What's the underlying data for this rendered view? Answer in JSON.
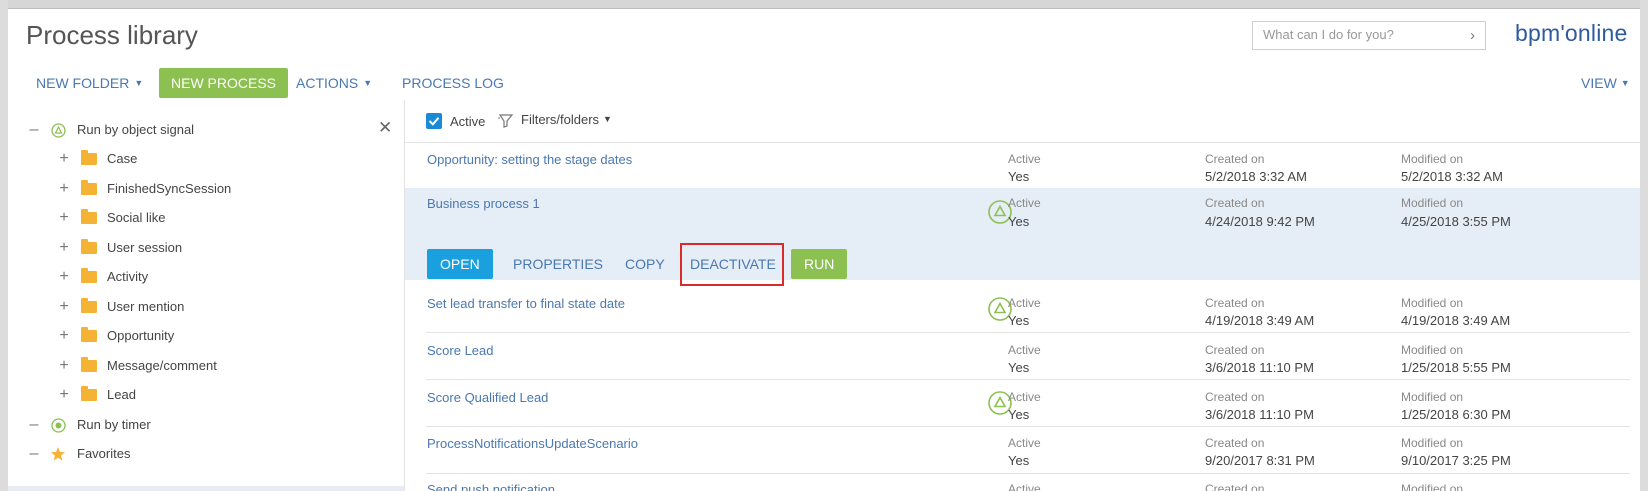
{
  "header": {
    "title": "Process library",
    "search_placeholder": "What can I do for you?",
    "brand": "bpm'online"
  },
  "toolbar": {
    "new_folder": "NEW FOLDER",
    "new_process": "NEW PROCESS",
    "actions": "ACTIONS",
    "process_log": "PROCESS LOG",
    "view": "VIEW"
  },
  "sidebar": {
    "root_signal": "Run by object signal",
    "folders": [
      "Case",
      "FinishedSyncSession",
      "Social like",
      "User session",
      "Activity",
      "User mention",
      "Opportunity",
      "Message/comment",
      "Lead"
    ],
    "timer": "Run by timer",
    "favorites": "Favorites"
  },
  "filter": {
    "active_label": "Active",
    "active_checked": true,
    "filters_label": "Filters/folders"
  },
  "columns": {
    "active": "Active",
    "created": "Created on",
    "modified": "Modified on"
  },
  "rows": [
    {
      "name": "Opportunity: setting the stage dates",
      "active": "Yes",
      "created": "5/2/2018 3:32 AM",
      "modified": "5/2/2018 3:32 AM",
      "signal": false
    },
    {
      "name": "Business process 1",
      "active": "Yes",
      "created": "4/24/2018 9:42 PM",
      "modified": "4/25/2018 3:55 PM",
      "signal": true
    },
    {
      "name": "Set lead transfer to final state date",
      "active": "Yes",
      "created": "4/19/2018 3:49 AM",
      "modified": "4/19/2018 3:49 AM",
      "signal": true
    },
    {
      "name": "Score Lead",
      "active": "Yes",
      "created": "3/6/2018 11:10 PM",
      "modified": "1/25/2018 5:55 PM",
      "signal": false
    },
    {
      "name": "Score Qualified Lead",
      "active": "Yes",
      "created": "3/6/2018 11:10 PM",
      "modified": "1/25/2018 6:30 PM",
      "signal": true
    },
    {
      "name": "ProcessNotificationsUpdateScenario",
      "active": "Yes",
      "created": "9/20/2017 8:31 PM",
      "modified": "9/10/2017 3:25 PM",
      "signal": false
    },
    {
      "name": "Send push notification",
      "active": "",
      "created": "",
      "modified": "",
      "signal": false
    }
  ],
  "row_actions": {
    "open": "OPEN",
    "properties": "PROPERTIES",
    "copy": "COPY",
    "deactivate": "DEACTIVATE",
    "run": "RUN"
  },
  "colors": {
    "accent_green": "#8cc152",
    "accent_blue": "#1aa0df",
    "link": "#4a78b0",
    "highlight": "#d92b2b",
    "selected_row": "#e5edf7"
  }
}
